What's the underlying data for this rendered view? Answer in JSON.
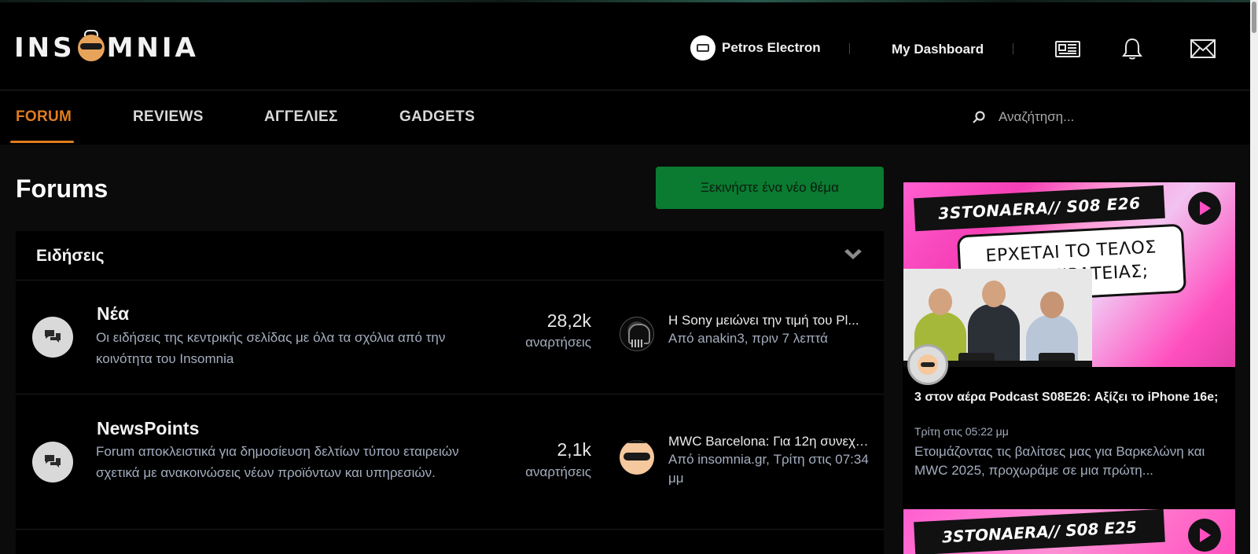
{
  "header": {
    "logo_text_left": "INS",
    "logo_text_right": "MNIA",
    "user_name": "Petros Electron",
    "dashboard_label": "My Dashboard"
  },
  "nav": {
    "items": [
      {
        "label": "FORUM",
        "active": true
      },
      {
        "label": "REVIEWS",
        "active": false
      },
      {
        "label": "ΑΓΓΕΛΙΕΣ",
        "active": false
      },
      {
        "label": "GADGETS",
        "active": false
      }
    ],
    "search_placeholder": "Αναζήτηση...",
    "accent_color": "#e07d20"
  },
  "main": {
    "page_title": "Forums",
    "new_topic_label": "Ξεκινήστε ένα νέο θέμα",
    "new_topic_color": "#0a7b30",
    "section": {
      "title": "Ειδήσεις",
      "forums": [
        {
          "name": "Νέα",
          "description": "Οι ειδήσεις της κεντρικής σελίδας με όλα τα σχόλια από την κοινότητα του Insomnia",
          "count": "28,2k",
          "count_label": "αναρτήσεις",
          "last_title": "Η Sony μειώνει την τιμή του Pl...",
          "last_meta": "Από anakin3, πριν 7 λεπτά",
          "last_avatar_icon": "darth-vader-avatar"
        },
        {
          "name": "NewsPoints",
          "description": "Forum αποκλειστικά για δημοσίευση δελτίων τύπου εταιρειών σχετικά με ανακοινώσεις νέων προϊόντων και υπηρεσιών.",
          "count": "2,1k",
          "count_label": "αναρτήσεις",
          "last_title": "MWC Barcelona: Για 12η συνεχό...",
          "last_meta": "Από insomnia.gr, Τρίτη στις 07:34 μμ",
          "last_avatar_icon": "insomnia-logo-avatar"
        }
      ]
    }
  },
  "sidebar": {
    "video1": {
      "tag": "3STONAERA// S08 E26",
      "card_line1": "ΕΡΧΕΤΑΙ ΤΟ ΤΕΛΟΣ",
      "card_line2": "ΤΗΣ ΠΕΙΡΑΤΕΙΑΣ;"
    },
    "post_title": "3 στον αέρα Podcast S08E26: Αξίζει το iPhone 16e;",
    "post_date": "Τρίτη στις 05:22 μμ",
    "post_desc": "Ετοιμάζοντας τις βαλίτσες μας για Βαρκελώνη και MWC 2025, προχωράμε σε μια πρώτη...",
    "video2": {
      "tag": "3STONAERA// S08 E25"
    }
  }
}
